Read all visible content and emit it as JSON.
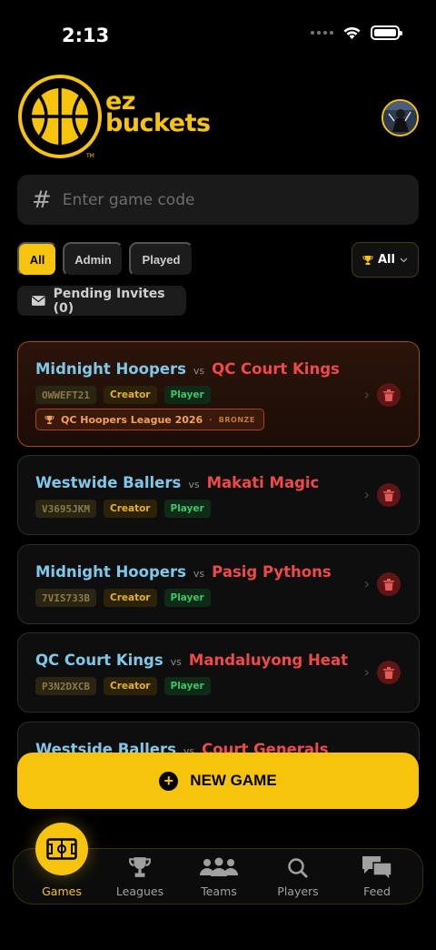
{
  "status_bar": {
    "time": "2:13"
  },
  "header": {
    "logo_line1": "ez",
    "logo_line2": "buckets",
    "logo_tm": "TM"
  },
  "search": {
    "hash": "#",
    "placeholder": "Enter game code"
  },
  "filters": {
    "chips": [
      "All",
      "Admin",
      "Played"
    ],
    "trophy_filter": "All",
    "pending_invites": "Pending Invites (0)"
  },
  "games": [
    {
      "home": "Midnight Hoopers",
      "vs": "vs",
      "away": "QC Court Kings",
      "code": "OWWEFT21",
      "creator": "Creator",
      "player": "Player",
      "league": "QC Hoopers League 2026",
      "league_sep": "·",
      "tier": "BRONZE"
    },
    {
      "home": "Westwide Ballers",
      "vs": "vs",
      "away": "Makati Magic",
      "code": "V3695JKM",
      "creator": "Creator",
      "player": "Player"
    },
    {
      "home": "Midnight Hoopers",
      "vs": "vs",
      "away": "Pasig Pythons",
      "code": "7VIS733B",
      "creator": "Creator",
      "player": "Player"
    },
    {
      "home": "QC Court Kings",
      "vs": "vs",
      "away": "Mandaluyong Heat",
      "code": "P3N2DXCB",
      "creator": "Creator",
      "player": "Player"
    },
    {
      "home": "Westside Ballers",
      "vs": "vs",
      "away": "Court Generals"
    }
  ],
  "new_game": {
    "label": "NEW GAME",
    "icon": "+"
  },
  "tabs": [
    {
      "label": "Games",
      "icon": "court-icon",
      "active": true
    },
    {
      "label": "Leagues",
      "icon": "trophy-icon"
    },
    {
      "label": "Teams",
      "icon": "team-icon"
    },
    {
      "label": "Players",
      "icon": "search-icon"
    },
    {
      "label": "Feed",
      "icon": "chat-icon"
    }
  ],
  "colors": {
    "accent": "#f6c40c",
    "home_team": "#7fc8e8",
    "away_team": "#f0494a",
    "background": "#000000"
  }
}
